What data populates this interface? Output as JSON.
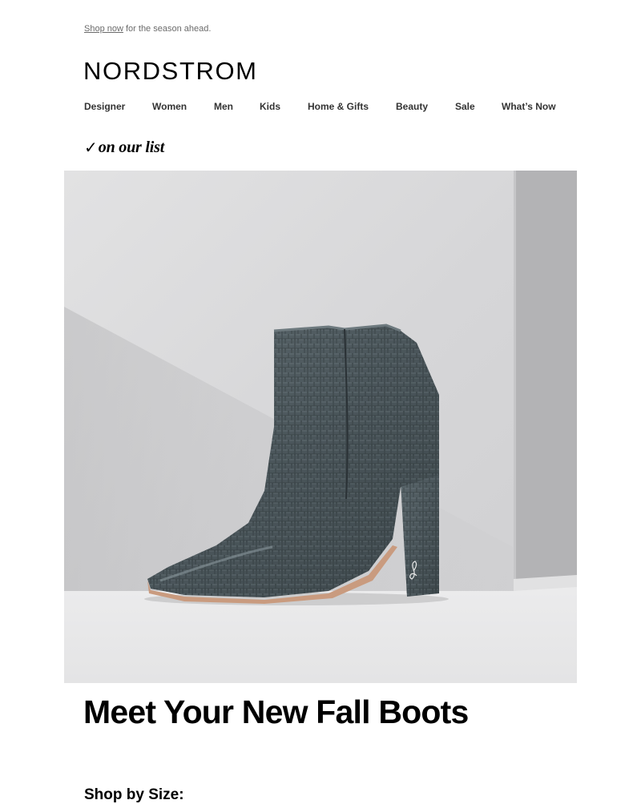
{
  "preheader": {
    "link_text": "Shop now",
    "text": " for the season ahead."
  },
  "brand": {
    "logo_text": "NORDSTROM"
  },
  "nav": {
    "items": [
      {
        "label": "Designer"
      },
      {
        "label": "Women"
      },
      {
        "label": "Men"
      },
      {
        "label": "Kids"
      },
      {
        "label": "Home & Gifts"
      },
      {
        "label": "Beauty"
      },
      {
        "label": "Sale"
      },
      {
        "label": "What’s Now"
      }
    ]
  },
  "tagline": {
    "check": "✓",
    "text": "on our list"
  },
  "hero": {
    "icon": "croc-ankle-boot-image",
    "boot_color": "#4e5a5f"
  },
  "headline": {
    "text": "Meet Your New Fall Boots"
  },
  "shop_by_size": {
    "label": "Shop by Size:"
  }
}
